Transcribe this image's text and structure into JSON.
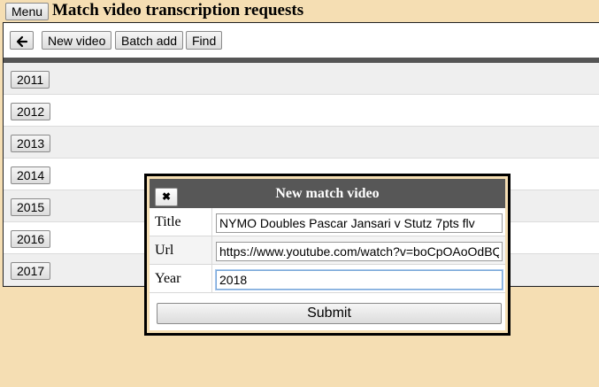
{
  "header": {
    "menu_label": "Menu",
    "title": "Match video transcription requests"
  },
  "toolbar": {
    "back_glyph": "🡐",
    "new_video_label": "New video",
    "batch_add_label": "Batch add",
    "find_label": "Find"
  },
  "years": [
    "2011",
    "2012",
    "2013",
    "2014",
    "2015",
    "2016",
    "2017"
  ],
  "dialog": {
    "title": "New match video",
    "close_glyph": "✖",
    "fields": {
      "title_label": "Title",
      "title_value": "NYMO Doubles Pascar Jansari v Stutz 7pts flv",
      "url_label": "Url",
      "url_value": "https://www.youtube.com/watch?v=boCpOAoOdBQ",
      "year_label": "Year",
      "year_value": "2018"
    },
    "submit_label": "Submit"
  },
  "colors": {
    "background": "#f5deb3",
    "dialog_header": "#575757",
    "toolbar_divider": "#555555"
  }
}
